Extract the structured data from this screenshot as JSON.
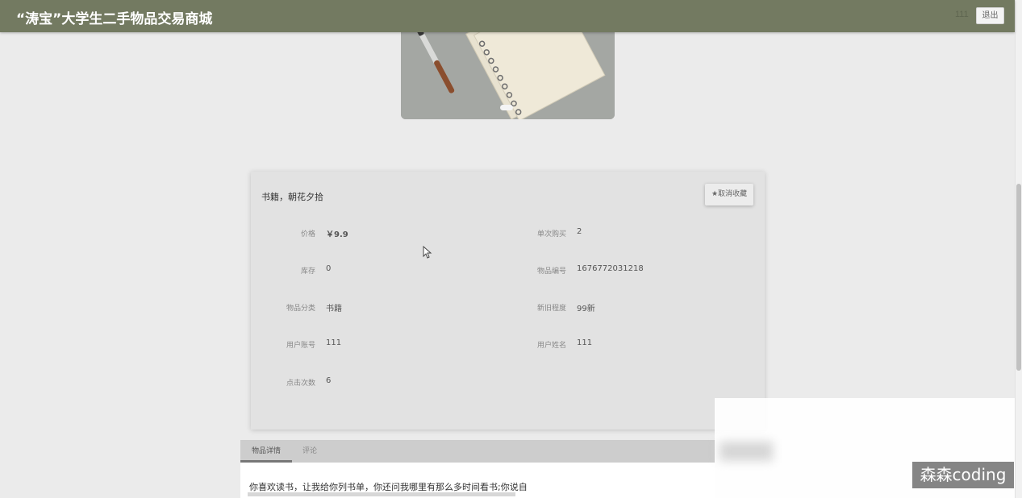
{
  "header": {
    "site_title": "“涛宝”大学生二手物品交易商城",
    "user_label": "111",
    "logout_label": "退出",
    "bg_color": "#737a61"
  },
  "carousel": {
    "image_icon": "notebook-photo",
    "active_slide": 1
  },
  "detail": {
    "title": "书籍，朝花夕拾",
    "favorite_button": "★取消收藏",
    "fields": [
      {
        "label": "价格",
        "value": "￥9.9"
      },
      {
        "label": "单次购买",
        "value": "2"
      },
      {
        "label": "库存",
        "value": "0"
      },
      {
        "label": "物品编号",
        "value": "1676772031218"
      },
      {
        "label": "物品分类",
        "value": "书籍"
      },
      {
        "label": "新旧程度",
        "value": "99新"
      },
      {
        "label": "用户账号",
        "value": "111"
      },
      {
        "label": "用户姓名",
        "value": "111"
      },
      {
        "label": "点击次数",
        "value": "6"
      }
    ]
  },
  "tabs": {
    "items": [
      {
        "label": "物品详情",
        "active": true
      },
      {
        "label": "评论",
        "active": false
      }
    ],
    "description": "你喜欢读书，让我给你列书单，你还问我哪里有那么多时间看书;你说自"
  },
  "watermark": "森森coding"
}
